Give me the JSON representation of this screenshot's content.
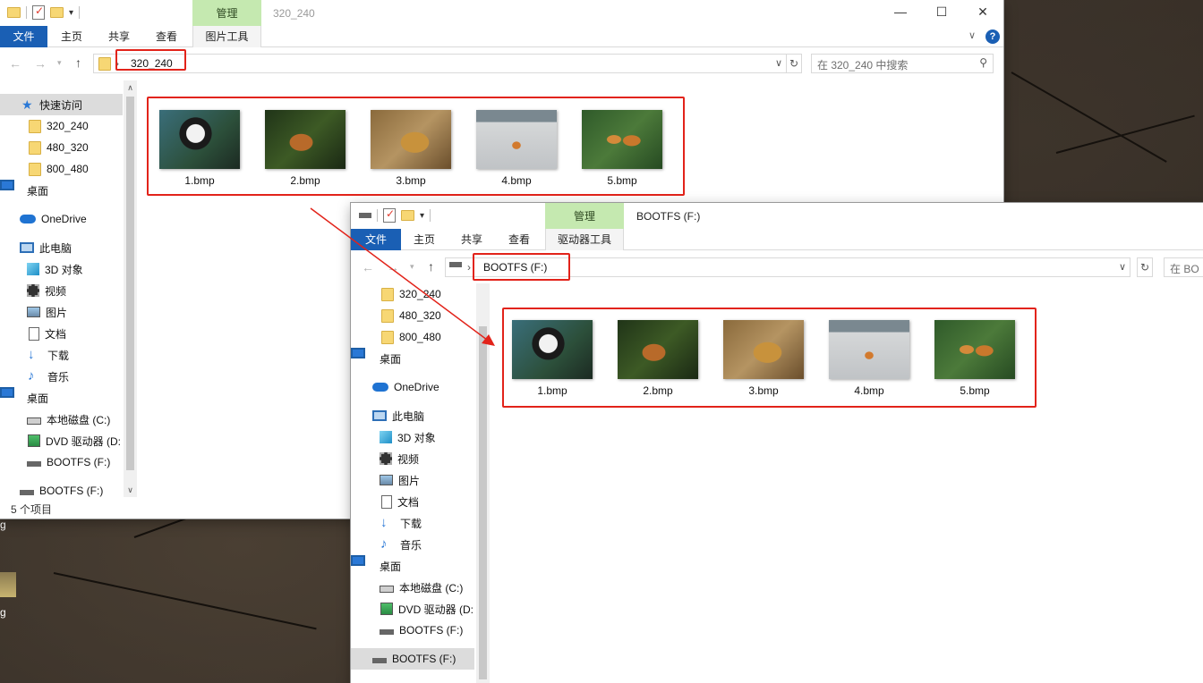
{
  "desktop": {
    "labels": [
      "g",
      "g"
    ]
  },
  "back_window": {
    "title": "320_240",
    "manage_tab": "管理",
    "tabs": {
      "file": "文件",
      "home": "主页",
      "share": "共享",
      "view": "查看",
      "tool": "图片工具"
    },
    "caption": {
      "minimize": "—",
      "maximize": "☐",
      "close": "✕"
    },
    "address": {
      "path": "320_240",
      "separator": "›"
    },
    "search_placeholder": "在 320_240 中搜索",
    "nav": {
      "quick_access": "快速访问",
      "folders": [
        "320_240",
        "480_320",
        "800_480"
      ],
      "desktop": "桌面",
      "onedrive": "OneDrive",
      "this_pc": "此电脑",
      "objects_3d": "3D 对象",
      "videos": "视频",
      "pictures": "图片",
      "documents": "文档",
      "downloads": "下载",
      "music": "音乐",
      "desktop2": "桌面",
      "local_disk": "本地磁盘 (C:)",
      "dvd": "DVD 驱动器 (D:",
      "bootfs": "BOOTFS (F:)",
      "bootfs2": "BOOTFS (F:)"
    },
    "files": [
      "1.bmp",
      "2.bmp",
      "3.bmp",
      "4.bmp",
      "5.bmp"
    ],
    "status": "5 个项目"
  },
  "front_window": {
    "title": "BOOTFS (F:)",
    "manage_tab": "管理",
    "tabs": {
      "file": "文件",
      "home": "主页",
      "share": "共享",
      "view": "查看",
      "tool": "驱动器工具"
    },
    "address": {
      "path": "BOOTFS (F:)",
      "separator": "›"
    },
    "search_placeholder": "在 BO",
    "nav": {
      "folders": [
        "320_240",
        "480_320",
        "800_480"
      ],
      "desktop": "桌面",
      "onedrive": "OneDrive",
      "this_pc": "此电脑",
      "objects_3d": "3D 对象",
      "videos": "视频",
      "pictures": "图片",
      "documents": "文档",
      "downloads": "下载",
      "music": "音乐",
      "desktop2": "桌面",
      "local_disk": "本地磁盘 (C:)",
      "dvd": "DVD 驱动器 (D:",
      "bootfs": "BOOTFS (F:)",
      "bootfs2": "BOOTFS (F:)"
    },
    "files": [
      "1.bmp",
      "2.bmp",
      "3.bmp",
      "4.bmp",
      "5.bmp"
    ]
  },
  "colors": {
    "highlight": "#e2231a",
    "ribbon_file": "#1a5fb4",
    "manage": "#c5e9b0"
  }
}
